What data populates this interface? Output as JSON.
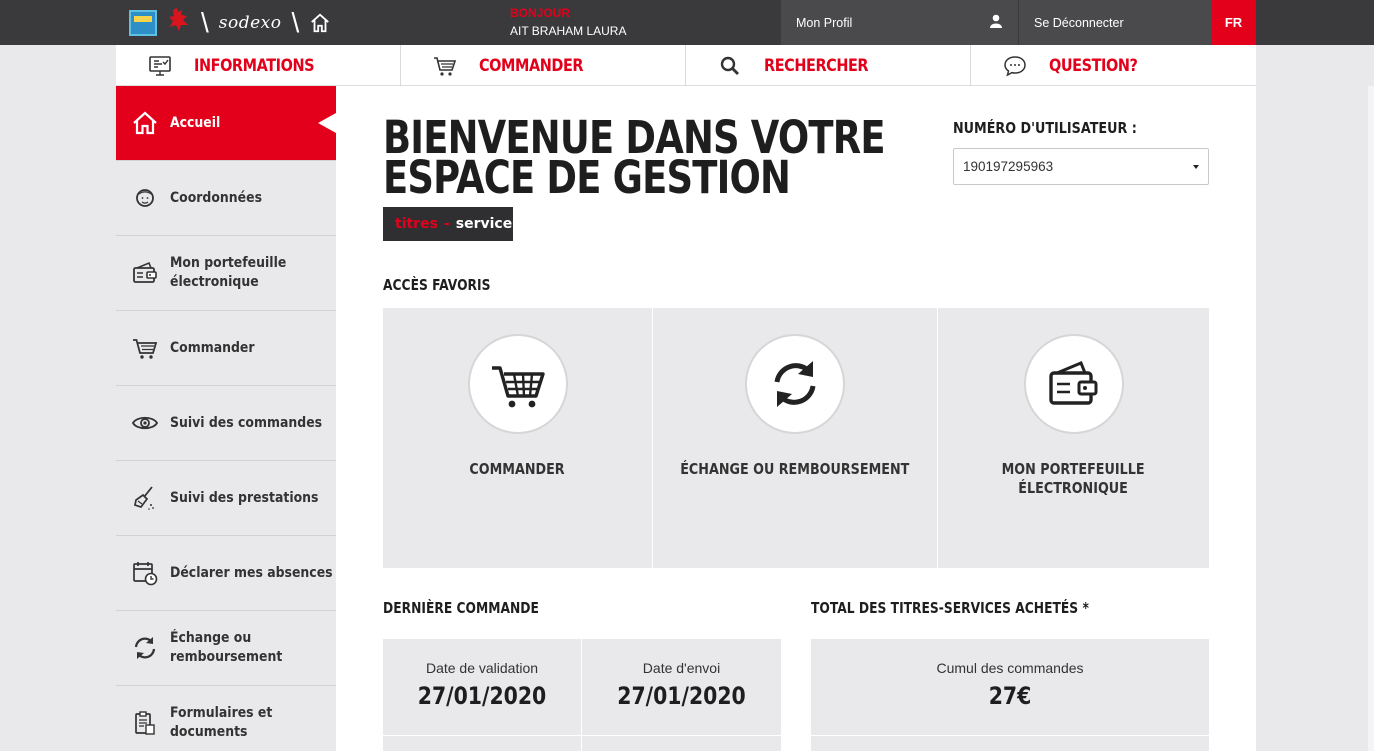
{
  "topbar": {
    "brand": "sodexo",
    "greeting_label": "BONJOUR",
    "user_name": "AIT BRAHAM LAURA",
    "profile_label": "Mon Profil",
    "logout_label": "Se Déconnecter",
    "language": "FR"
  },
  "nav": [
    {
      "label": "INFORMATIONS",
      "icon": "monitor-icon"
    },
    {
      "label": "COMMANDER",
      "icon": "cart-icon"
    },
    {
      "label": "RECHERCHER",
      "icon": "search-icon"
    },
    {
      "label": "QUESTION?",
      "icon": "chat-bubble-icon"
    }
  ],
  "sidebar": {
    "items": [
      {
        "label": "Accueil",
        "icon": "home-icon",
        "active": true
      },
      {
        "label": "Coordonnées",
        "icon": "person-icon"
      },
      {
        "label": "Mon portefeuille\nélectronique",
        "line1": "Mon portefeuille",
        "line2": "électronique",
        "icon": "wallet-icon"
      },
      {
        "label": "Commander",
        "icon": "cart-icon"
      },
      {
        "label": "Suivi des commandes",
        "icon": "eye-icon"
      },
      {
        "label": "Suivi des prestations",
        "icon": "broom-icon"
      },
      {
        "label": "Déclarer mes absences",
        "icon": "calendar-clock-icon"
      },
      {
        "label": "Échange ou\nremboursement",
        "line1": "Échange ou",
        "line2": "remboursement",
        "icon": "exchange-icon"
      },
      {
        "label": "Formulaires et\ndocuments",
        "line1": "Formulaires et",
        "line2": "documents",
        "icon": "clipboard-icon"
      }
    ]
  },
  "main": {
    "title_line1": "BIENVENUE DANS VOTRE",
    "title_line2": "ESPACE DE GESTION",
    "badge_part1": "titres",
    "badge_sep": "-",
    "badge_part2": "services",
    "user_number_label": "NUMÉRO D'UTILISATEUR :",
    "user_number_value": "190197295963",
    "favorites_title": "ACCÈS FAVORIS",
    "favorites": [
      {
        "label": "COMMANDER",
        "icon": "cart-icon"
      },
      {
        "label": "ÉCHANGE OU REMBOURSEMENT",
        "icon": "exchange-icon"
      },
      {
        "label_line1": "MON PORTEFEUILLE",
        "label_line2": "ÉLECTRONIQUE",
        "icon": "wallet-icon"
      }
    ],
    "last_order_title": "DERNIÈRE COMMANDE",
    "last_order": {
      "validation_label": "Date de validation",
      "validation_date": "27/01/2020",
      "sent_label": "Date d'envoi",
      "sent_date": "27/01/2020"
    },
    "total_title": "TOTAL DES TITRES-SERVICES ACHETÉS *",
    "total": {
      "label": "Cumul des commandes",
      "value": "27€"
    }
  },
  "colors": {
    "accent": "#e2001a",
    "dark": "#3a3a3c",
    "panel": "#e9e9ec"
  }
}
